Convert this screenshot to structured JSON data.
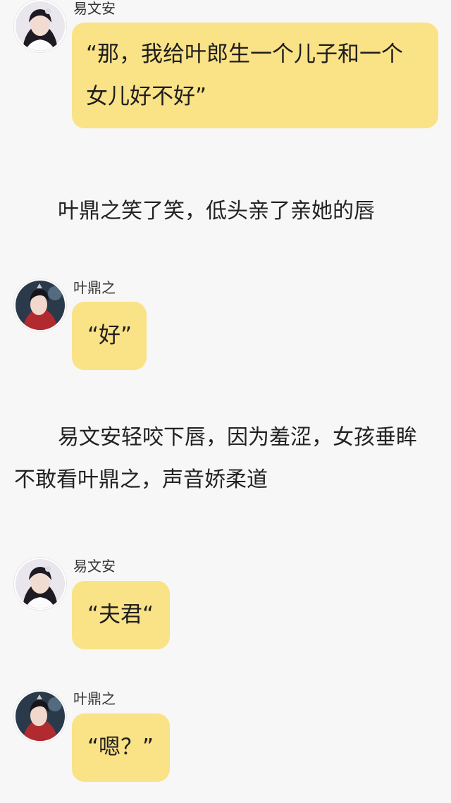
{
  "messages": [
    {
      "speaker": "易文安",
      "text": "“那，我给叶郎生一个儿子和一个女儿好不好”"
    },
    {
      "speaker": "叶鼎之",
      "text": "“好”"
    },
    {
      "speaker": "易文安",
      "text": "“夫君“"
    },
    {
      "speaker": "叶鼎之",
      "text": "“嗯？”"
    }
  ],
  "narration": [
    "叶鼎之笑了笑，低头亲了亲她的唇",
    "易文安轻咬下唇，因为羞涩，女孩垂眸不敢看叶鼎之，声音娇柔道"
  ],
  "colors": {
    "bubble": "#fae286",
    "background": "#f7f7f7"
  },
  "icons": {
    "female_avatar": "avatar-female-icon",
    "male_avatar": "avatar-male-icon"
  }
}
